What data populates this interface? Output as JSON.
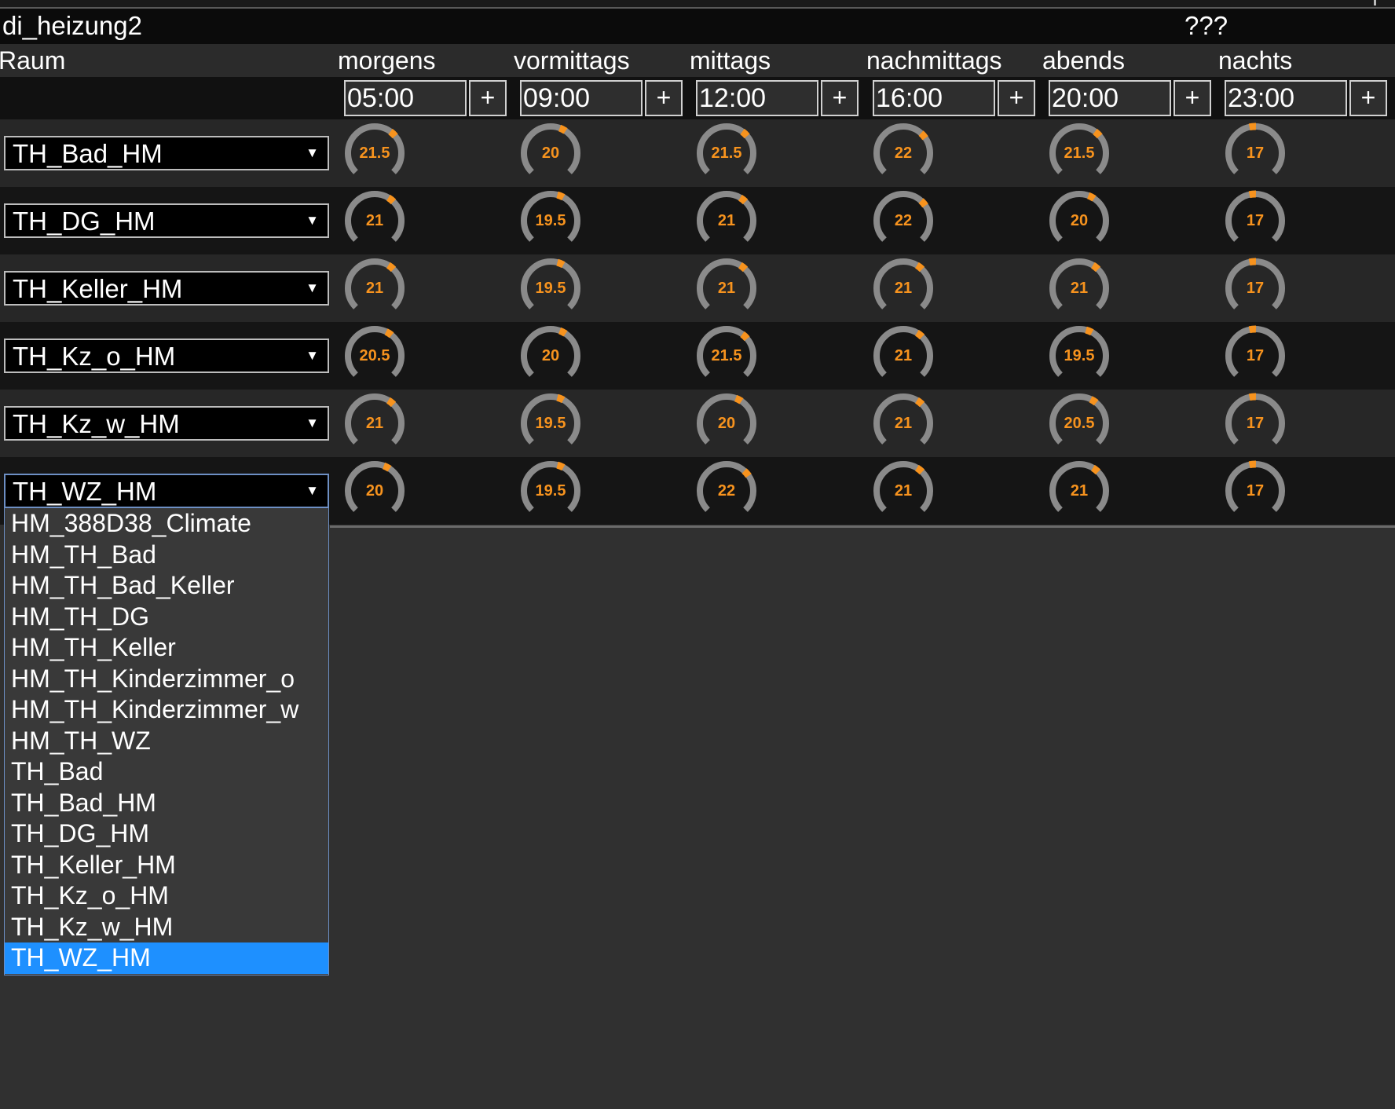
{
  "title": "di_heizung2",
  "status": "???",
  "header": {
    "room_label": "Raum",
    "periods": [
      "morgens",
      "vormittags",
      "mittags",
      "nachmittags",
      "abends",
      "nachts"
    ]
  },
  "times": [
    "05:00",
    "09:00",
    "12:00",
    "16:00",
    "20:00",
    "23:00"
  ],
  "plus_label": "+",
  "gauge_range": {
    "min": 5,
    "max": 30
  },
  "colors": {
    "accent": "#f7931e",
    "track": "#8a8a8a",
    "selected": "#1e90ff"
  },
  "rooms": [
    {
      "device": "TH_Bad_HM",
      "temps": [
        "21.5",
        "20",
        "21.5",
        "22",
        "21.5",
        "17"
      ]
    },
    {
      "device": "TH_DG_HM",
      "temps": [
        "21",
        "19.5",
        "21",
        "22",
        "20",
        "17"
      ]
    },
    {
      "device": "TH_Keller_HM",
      "temps": [
        "21",
        "19.5",
        "21",
        "21",
        "21",
        "17"
      ]
    },
    {
      "device": "TH_Kz_o_HM",
      "temps": [
        "20.5",
        "20",
        "21.5",
        "21",
        "19.5",
        "17"
      ]
    },
    {
      "device": "TH_Kz_w_HM",
      "temps": [
        "21",
        "19.5",
        "20",
        "21",
        "20.5",
        "17"
      ]
    },
    {
      "device": "TH_WZ_HM",
      "temps": [
        "20",
        "19.5",
        "22",
        "21",
        "21",
        "17"
      ]
    }
  ],
  "dropdown": {
    "open_row": 5,
    "selected": "TH_WZ_HM",
    "options": [
      "HM_388D38_Climate",
      "HM_TH_Bad",
      "HM_TH_Bad_Keller",
      "HM_TH_DG",
      "HM_TH_Keller",
      "HM_TH_Kinderzimmer_o",
      "HM_TH_Kinderzimmer_w",
      "HM_TH_WZ",
      "TH_Bad",
      "TH_Bad_HM",
      "TH_DG_HM",
      "TH_Keller_HM",
      "TH_Kz_o_HM",
      "TH_Kz_w_HM",
      "TH_WZ_HM"
    ]
  }
}
